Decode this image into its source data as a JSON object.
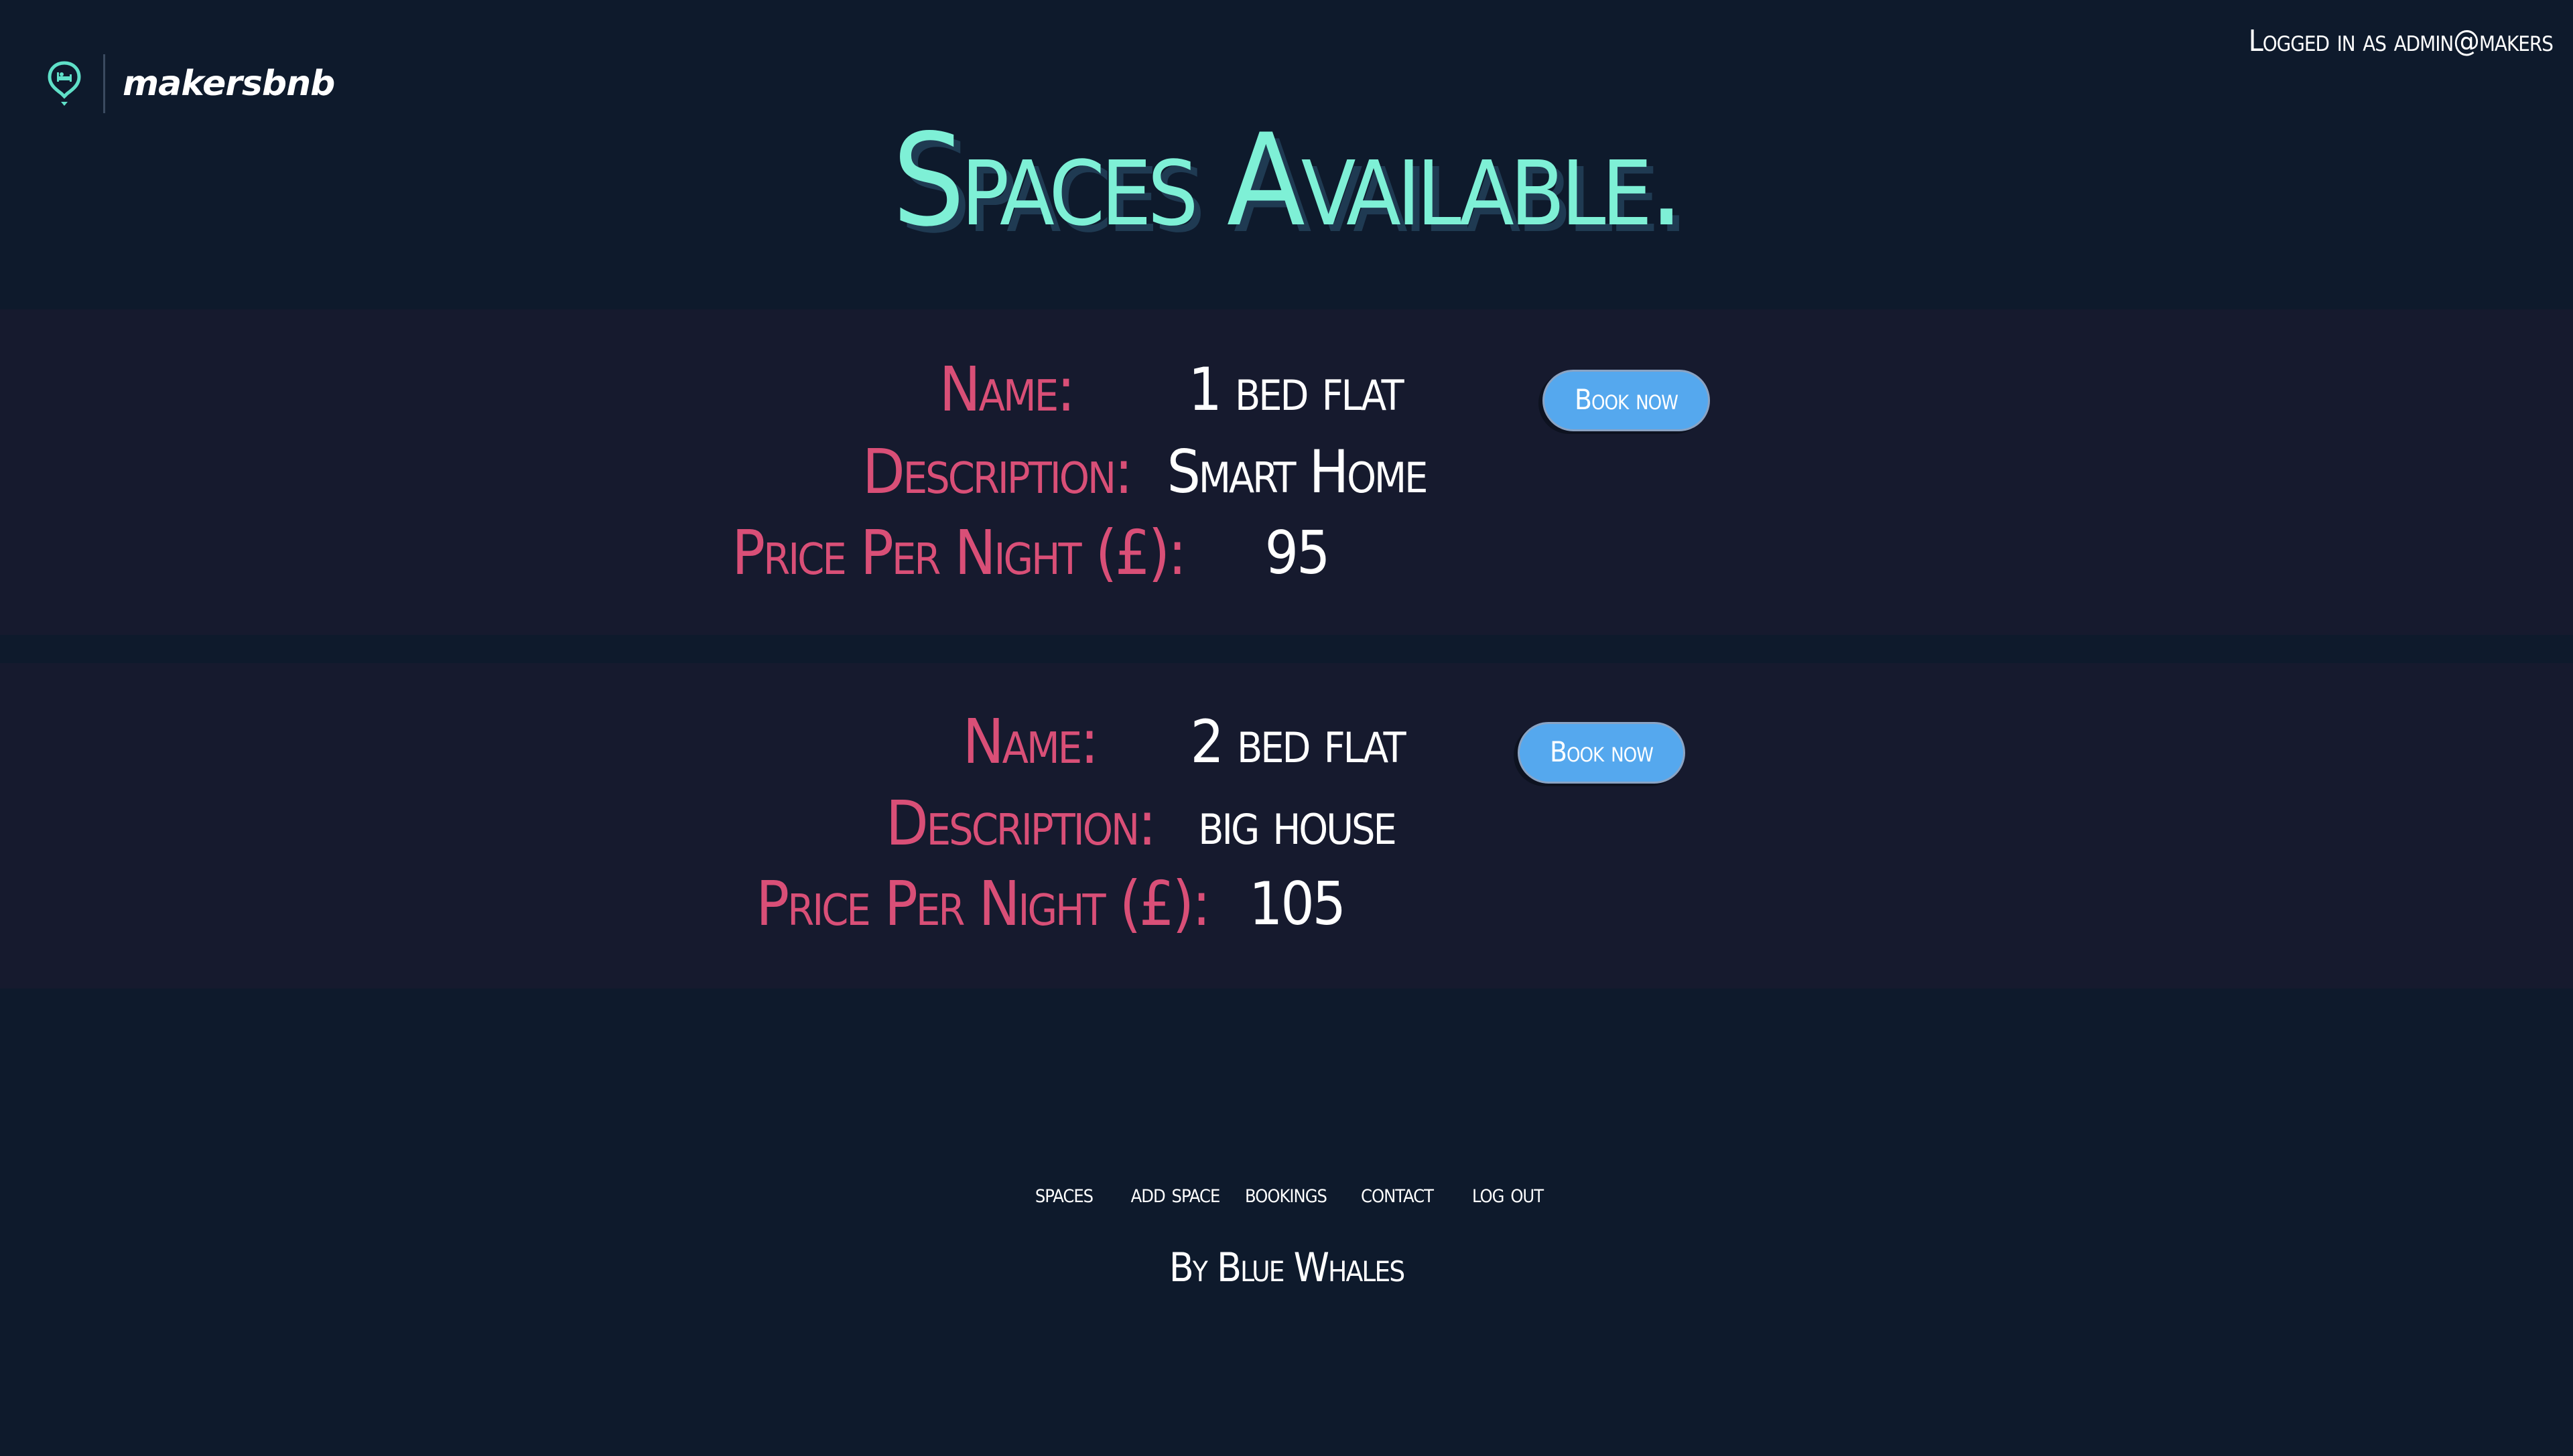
{
  "header": {
    "brand_name": "makersbnb",
    "login_status": "Logged in as admin@makers",
    "brand_icon": "map-pin-bed-icon"
  },
  "page_title": "Spaces Available.",
  "labels": {
    "name": "Name:",
    "description": "Description:",
    "price": "Price Per Night (£):"
  },
  "spaces": [
    {
      "name": "1 bed flat",
      "description": "Smart Home",
      "price": "95",
      "book_label": "Book now"
    },
    {
      "name": "2 bed flat",
      "description": "big house",
      "price": "105",
      "book_label": "Book now"
    }
  ],
  "footer": {
    "nav": [
      "spaces",
      "add space",
      "bookings",
      "contact",
      "log out"
    ],
    "credit": "By Blue Whales"
  },
  "colors": {
    "background": "#0e1a2c",
    "card_background": "#161a2e",
    "title": "#7ef0d6",
    "label": "#d94f77",
    "button": "#55a8ee",
    "icon": "#5fe0c8"
  }
}
